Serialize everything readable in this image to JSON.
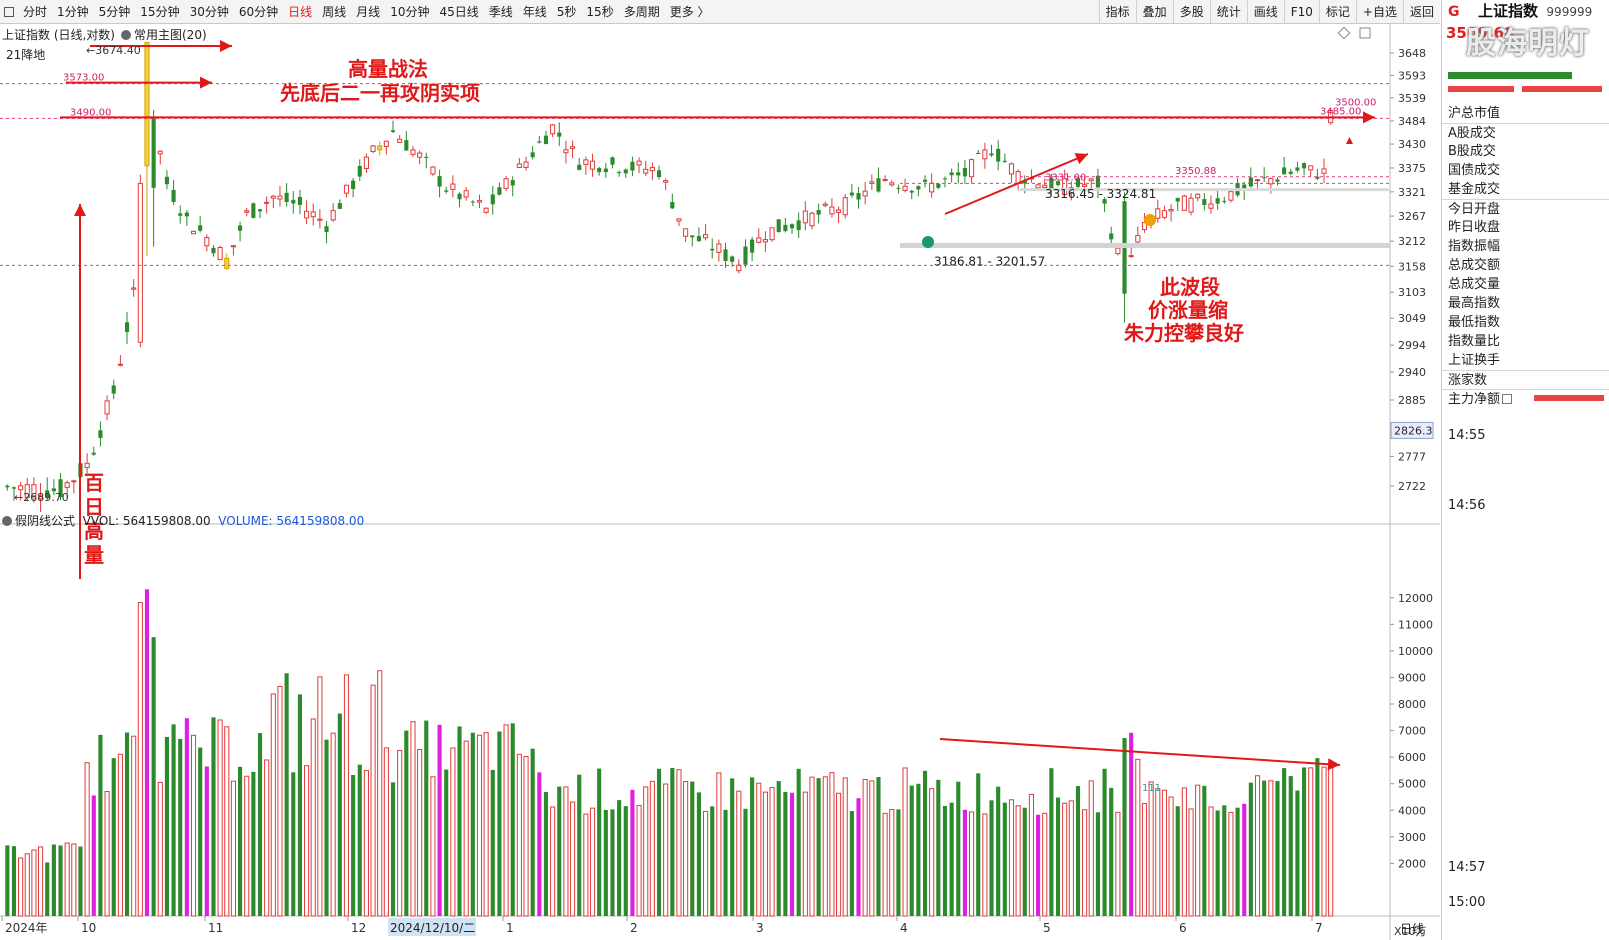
{
  "toolbar": {
    "periods": [
      "分时",
      "1分钟",
      "5分钟",
      "15分钟",
      "30分钟",
      "60分钟",
      "日线",
      "周线",
      "月线",
      "10分钟",
      "45日线",
      "季线",
      "年线",
      "5秒",
      "15秒",
      "多周期",
      "更多 〉"
    ],
    "active_period": "日线",
    "right_buttons": [
      "指标",
      "叠加",
      "多股",
      "统计",
      "画线",
      "F10",
      "标记",
      "+自选",
      "返回"
    ]
  },
  "main_panel": {
    "title": "上证指数 (日线,对数)",
    "template": "常用主图(20)",
    "sub_label": "21降地",
    "price_ticks": [
      "3648",
      "3593",
      "3539",
      "3484",
      "3430",
      "3375",
      "3321",
      "3267",
      "3212",
      "3158",
      "3103",
      "3049",
      "2994",
      "2940",
      "2885",
      "2826.3",
      "2777",
      "2722"
    ],
    "annotations": {
      "high_marker": "3674.40",
      "low_marker": "2689.70",
      "level_3573": "3573.00",
      "level_3490": "3490.00",
      "level_3500": "3500.00",
      "level_3485": "3485.00",
      "level_3331": "3331.00",
      "level_3350": "3350.88",
      "range_1": "3316.45 - 3324.81",
      "range_2": "3186.81 - 3201.57",
      "strategy_title": "高量战法",
      "strategy_sub": "先底后二一再攻阴实项",
      "note_line1": "此波段",
      "note_line2": "价涨量缩",
      "note_line3": "朱力控攀良好",
      "vertical_note": [
        "百",
        "日",
        "高",
        "量"
      ]
    }
  },
  "volume_panel": {
    "title": "假阴线公式",
    "vvol_label": "VVOL: 564159808.00",
    "volume_label": "VOLUME: 564159808.00",
    "ticks": [
      "12000",
      "11000",
      "10000",
      "9000",
      "8000",
      "7000",
      "6000",
      "5000",
      "4000",
      "3000",
      "2000"
    ],
    "unit": "X10万",
    "small_label": "111"
  },
  "x_axis": {
    "labels": [
      "2024年",
      "10",
      "11",
      "12",
      "2024/12/10/二",
      "1",
      "2",
      "3",
      "4",
      "5",
      "6",
      "7"
    ],
    "period_label": "日线"
  },
  "right_panel": {
    "g_label": "G",
    "title": "上证指数",
    "code": "999999",
    "price": "3509.68",
    "watermark": "股海明灯",
    "rows": [
      "沪总市值",
      "A股成交",
      "B股成交",
      "国债成交",
      "基金成交",
      "今日开盘",
      "昨日收盘",
      "指数振幅",
      "总成交额",
      "总成交量",
      "最高指数",
      "最低指数",
      "指数量比",
      "上证换手",
      "涨家数",
      "主力净额"
    ],
    "times": [
      "14:55",
      "14:56",
      "14:57",
      "15:00"
    ]
  },
  "chart_data": {
    "type": "candlestick",
    "title": "上证指数 (日线,对数)",
    "y_scale": "log",
    "ylim": [
      2680,
      3700
    ],
    "x_range": [
      "2024-09",
      "2025-07"
    ],
    "volume_unit": "X10万",
    "volume_ylim": [
      0,
      12500
    ],
    "key_levels": [
      3674.4,
      3573.0,
      3490.0,
      3500.0,
      3485.0,
      3331.0,
      3350.88,
      2689.7
    ],
    "ranges": [
      [
        3316.45,
        3324.81
      ],
      [
        3186.81,
        3201.57
      ]
    ],
    "last_price": 3509.68,
    "last_volume": 564159808.0
  }
}
